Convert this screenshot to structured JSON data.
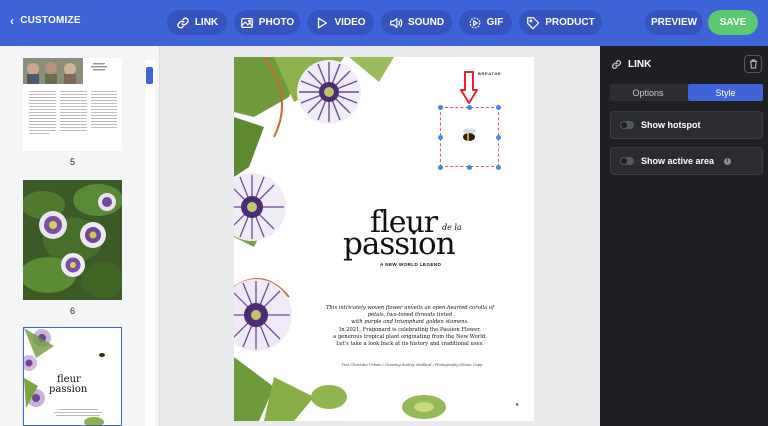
{
  "topbar": {
    "back_label": "CUSTOMIZE",
    "tools": [
      {
        "label": "LINK",
        "icon": "link-icon"
      },
      {
        "label": "PHOTO",
        "icon": "photo-icon"
      },
      {
        "label": "VIDEO",
        "icon": "play-icon"
      },
      {
        "label": "SOUND",
        "icon": "speaker-icon"
      },
      {
        "label": "GIF",
        "icon": "gif-icon"
      },
      {
        "label": "PRODUCT",
        "icon": "tag-icon"
      }
    ],
    "preview_label": "PREVIEW",
    "save_label": "SAVE",
    "colors": {
      "bar": "#3f63d9",
      "pill": "#3654bf",
      "save": "#5cc870"
    }
  },
  "pages_panel": {
    "pages": [
      {
        "number": "5"
      },
      {
        "number": "6"
      },
      {
        "number": ""
      }
    ]
  },
  "document": {
    "brand": "BREATHE",
    "title_main": "fleur",
    "title_small": "de la",
    "title_second": "passion",
    "subtitle": "A NEW WORLD LEGEND",
    "body_italic": [
      "This intricately woven flower unveils an open-hearted corolla of",
      "petals, two-toned threads tinted",
      "with purple and triumphant golden stamens."
    ],
    "body_regular": [
      "In 2021, Fragonard is celebrating the Passion Flower,",
      "a generous tropical plant originating from the New World.",
      "Let's take a look back at its history and traditional uses."
    ],
    "credits": "Text Charlotte Urbain / Drawing Audrey Maillard / Photography Olivier Capp",
    "page_number": "5"
  },
  "right_panel": {
    "title": "LINK",
    "tabs": [
      {
        "label": "Options",
        "active": false
      },
      {
        "label": "Style",
        "active": true
      }
    ],
    "toggles": [
      {
        "label": "Show hotspot",
        "on": false,
        "info": false
      },
      {
        "label": "Show active area",
        "on": false,
        "info": true
      }
    ]
  }
}
